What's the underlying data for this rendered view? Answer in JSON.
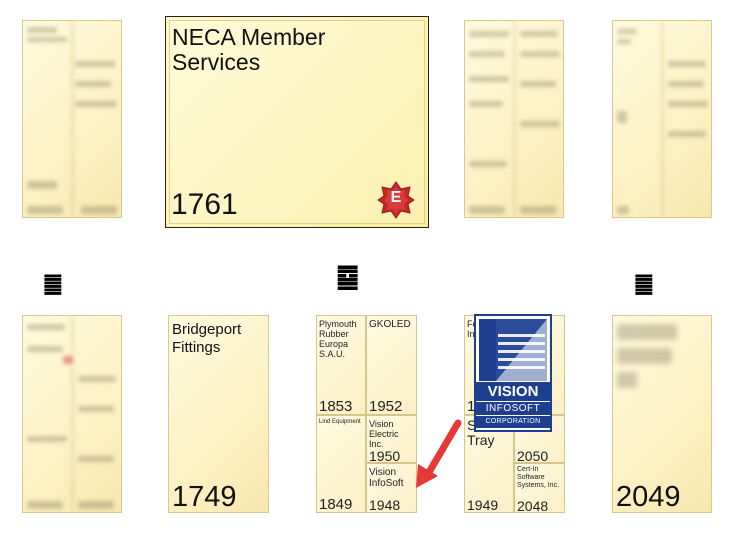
{
  "row1": {
    "tile_selected": {
      "title": "NECA Member Services",
      "number": "1761",
      "badge_letter": "E"
    }
  },
  "row2": {
    "glyph_left": "䷀",
    "glyph_mid": "䷈",
    "glyph_right": "䷀",
    "bridgeport": {
      "title": "Bridgeport Fittings",
      "number": "1749"
    },
    "cluster": {
      "c1": {
        "title": "Plymouth Rubber Europa S.A.U.",
        "number": "1853"
      },
      "c2": {
        "title": "GKOLED",
        "number": "1952"
      },
      "c3": {
        "title": "Lind Equipment",
        "number": "1849"
      },
      "c4": {
        "title": "Vision Electric Inc.",
        "number": "1950"
      },
      "c5": {
        "title": "Vision InfoSoft",
        "number": "1948"
      }
    },
    "cluster2": {
      "t1": {
        "title": "Fe In",
        "number": "1"
      },
      "t2": {
        "title": "S Tray",
        "number": "1949"
      },
      "t3": {
        "title": "",
        "number": "2050"
      },
      "t4": {
        "title": "Cert-In Software Systems, Inc.",
        "number": "2048"
      }
    },
    "right_tile": {
      "number": "2049"
    }
  },
  "logo": {
    "line1": "VISION",
    "line2": "INFOSOFT",
    "line3": "CORPORATION",
    "color": "#1e3f8f"
  },
  "accent": {
    "badge_red": "#c62828",
    "arrow_red": "#e53935"
  }
}
